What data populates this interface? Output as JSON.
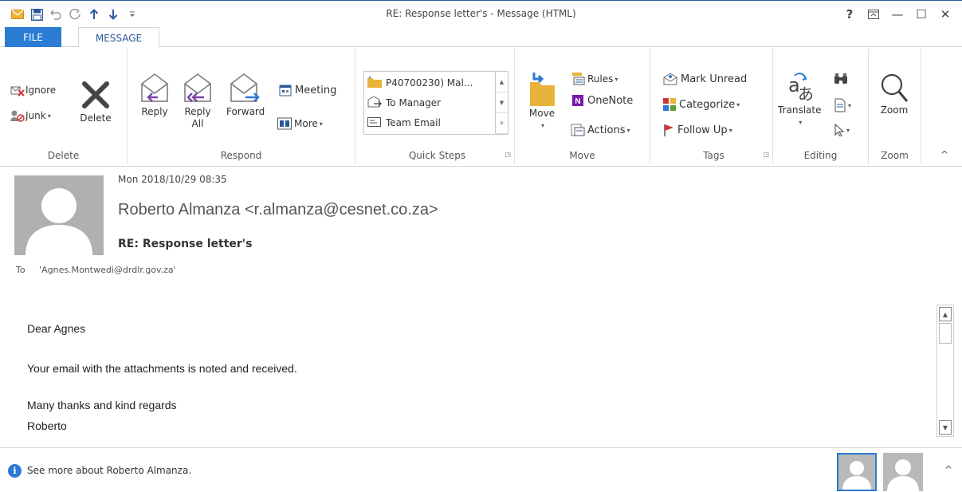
{
  "window": {
    "title": "RE: Response letter's - Message (HTML)",
    "help": "?",
    "ribbon_display": "⭱",
    "minimize": "—",
    "maximize": "☐",
    "close": "✕"
  },
  "qat": {
    "mail": "✉",
    "save": "💾",
    "undo": "↶",
    "redo": "↻",
    "up": "↑",
    "down": "↓",
    "customize": "⩦"
  },
  "tabs": {
    "file": "FILE",
    "message": "MESSAGE"
  },
  "ribbon": {
    "delete": {
      "ignore": "Ignore",
      "junk": "Junk",
      "delete": "Delete",
      "label": "Delete"
    },
    "respond": {
      "reply": "Reply",
      "reply_all_1": "Reply",
      "reply_all_2": "All",
      "forward": "Forward",
      "meeting": "Meeting",
      "more": "More",
      "label": "Respond"
    },
    "quick_steps": {
      "items": [
        "P40700230) Mal...",
        "To Manager",
        "Team Email"
      ],
      "label": "Quick Steps"
    },
    "move": {
      "move": "Move",
      "rules": "Rules",
      "onenote": "OneNote",
      "actions": "Actions",
      "label": "Move"
    },
    "tags": {
      "mark_unread": "Mark Unread",
      "categorize": "Categorize",
      "follow_up": "Follow Up",
      "label": "Tags"
    },
    "editing": {
      "translate": "Translate",
      "label": "Editing"
    },
    "zoom": {
      "zoom": "Zoom",
      "label": "Zoom"
    },
    "collapse": "^"
  },
  "message": {
    "date": "Mon 2018/10/29 08:35",
    "sender": "Roberto Almanza <r.almanza@cesnet.co.za>",
    "subject": "RE: Response letter's",
    "to_label": "To",
    "to_addr": "'Agnes.Montwedi@drdlr.gov.za'",
    "body": {
      "greeting": "Dear Agnes",
      "line1": "Your email with the attachments is noted and received.",
      "closing": "Many thanks and kind regards",
      "signature": "Roberto"
    }
  },
  "people_pane": {
    "see_more": "See more about Roberto Almanza.",
    "collapse": "^"
  },
  "colors": {
    "accent": "#2b579a",
    "file_tab": "#2b7cd3",
    "info": "#2b79d4"
  }
}
